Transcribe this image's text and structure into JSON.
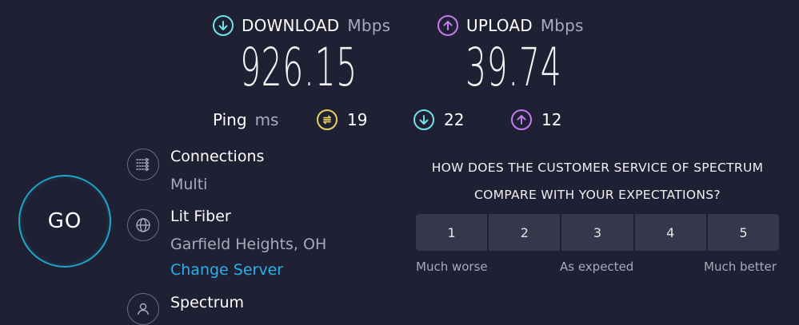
{
  "download": {
    "title": "DOWNLOAD",
    "unit": "Mbps",
    "value": "926.15",
    "icon": "download-arrow-icon",
    "color": "#6ee3e8"
  },
  "upload": {
    "title": "UPLOAD",
    "unit": "Mbps",
    "value": "39.74",
    "icon": "upload-arrow-icon",
    "color": "#c27cf2"
  },
  "ping": {
    "label": "Ping",
    "unit": "ms",
    "idle": "19",
    "download": "22",
    "upload": "12",
    "idle_color": "#e8d15a"
  },
  "go_button": {
    "label": "GO"
  },
  "connections": {
    "title": "Connections",
    "value": "Multi"
  },
  "server": {
    "title": "Lit Fiber",
    "location": "Garfield Heights, OH",
    "change_link": "Change Server"
  },
  "provider": {
    "title": "Spectrum"
  },
  "survey": {
    "question_line1": "HOW DOES THE CUSTOMER SERVICE OF SPECTRUM",
    "question_line2": "COMPARE WITH YOUR EXPECTATIONS?",
    "options": [
      "1",
      "2",
      "3",
      "4",
      "5"
    ],
    "label_low": "Much worse",
    "label_mid": "As expected",
    "label_high": "Much better"
  }
}
